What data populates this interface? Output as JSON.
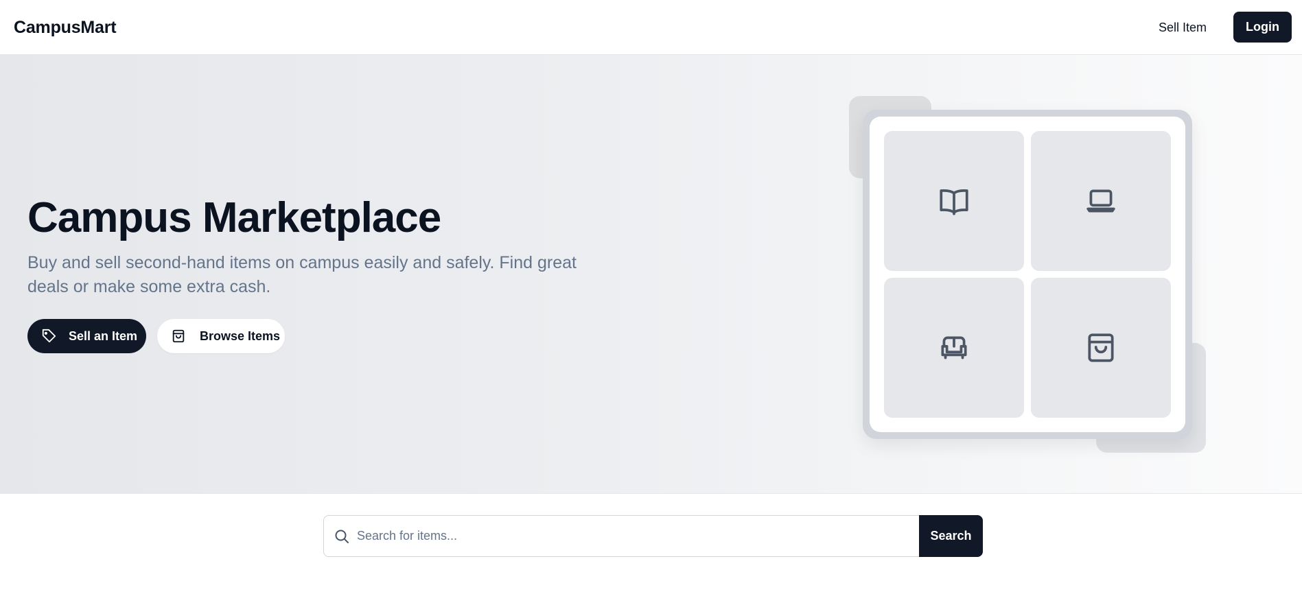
{
  "nav": {
    "brand": "CampusMart",
    "sell_link": "Sell Item",
    "login_button": "Login"
  },
  "hero": {
    "title": "Campus Marketplace",
    "subtitle": "Buy and sell second-hand items on campus easily and safely. Find great deals or make some extra cash.",
    "primary_button": "Sell an Item",
    "secondary_button": "Browse Items",
    "primary_icon": "tag-icon",
    "secondary_icon": "shopping-bag-icon",
    "illustration_tiles": [
      "book-icon",
      "laptop-icon",
      "sofa-icon",
      "shopping-bag-icon"
    ]
  },
  "search": {
    "placeholder": "Search for items...",
    "value": "",
    "button": "Search",
    "icon": "search-icon"
  },
  "colors": {
    "primary": "#111827",
    "muted_text": "#64748b",
    "tile": "#e5e7eb",
    "icon_stroke": "#4b5563"
  }
}
